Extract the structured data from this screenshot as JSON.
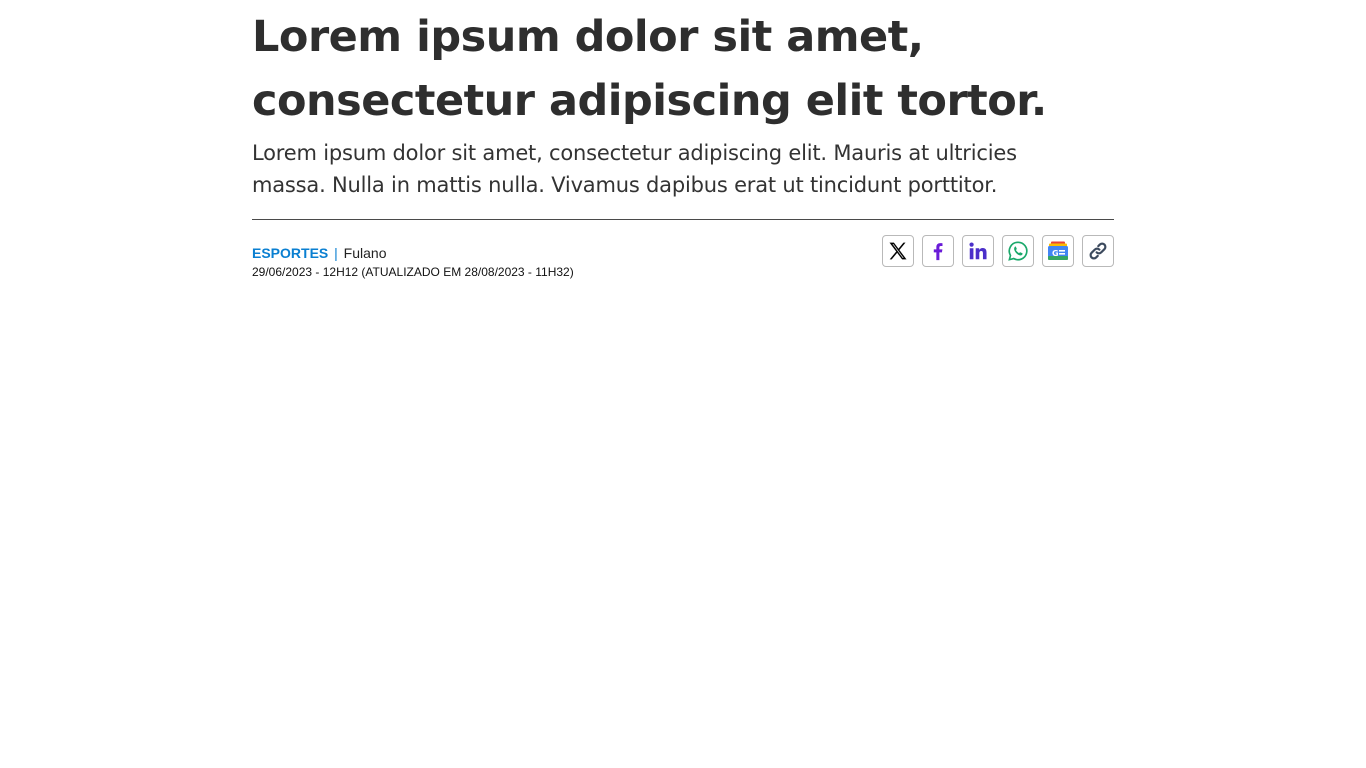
{
  "article": {
    "headline": "Lorem ipsum dolor sit amet,\nconsectetur adipiscing elit tortor.",
    "subheadline": "Lorem ipsum dolor sit amet, consectetur adipiscing elit. Mauris at ultricies\nmassa. Nulla in mattis nulla. Vivamus dapibus erat ut tincidunt porttitor.",
    "section": "ESPORTES",
    "separator": "|",
    "author": "Fulano",
    "timestamp": "29/06/2023 - 12H12 (ATUALIZADO EM 28/08/2023 - 11H32)"
  },
  "share": {
    "buttons": [
      {
        "icon": "x-twitter-icon",
        "color": "#000000"
      },
      {
        "icon": "facebook-icon",
        "color": "#6a1bd8"
      },
      {
        "icon": "linkedin-icon",
        "color": "#4b2fc9"
      },
      {
        "icon": "whatsapp-icon",
        "color": "#1aa86a"
      },
      {
        "icon": "google-news-icon",
        "color": "#4285f4"
      },
      {
        "icon": "copy-link-icon",
        "color": "#3c4a5e"
      }
    ]
  },
  "colors": {
    "section_accent": "#0a7fd1",
    "text": "#2e2e2e"
  }
}
